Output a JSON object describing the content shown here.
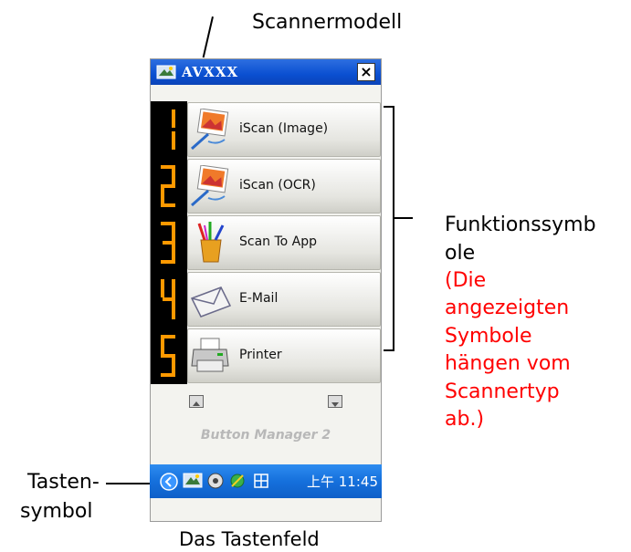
{
  "labels": {
    "scanner_model": "Scannermodell",
    "function_icons_1": "Funktionssymb",
    "function_icons_2": "ole",
    "note": [
      "(Die",
      "angezeigten",
      "Symbole",
      "hängen vom",
      "Scannertyp",
      "ab.)"
    ],
    "tray_icon_1": "Tasten-",
    "tray_icon_2": "symbol",
    "caption": "Das Tastenfeld"
  },
  "panel": {
    "title": "AVXXX",
    "close": "×",
    "buttons": [
      {
        "digit": "1",
        "label": "iScan (Image)",
        "icon": "image-scan-icon"
      },
      {
        "digit": "2",
        "label": "iScan (OCR)",
        "icon": "ocr-scan-icon"
      },
      {
        "digit": "3",
        "label": "Scan To App",
        "icon": "brush-cup-icon"
      },
      {
        "digit": "4",
        "label": "E-Mail",
        "icon": "envelope-icon"
      },
      {
        "digit": "5",
        "label": "Printer",
        "icon": "printer-icon"
      }
    ],
    "footer_label": "Button Manager 2"
  },
  "taskbar": {
    "clock": "上午 11:45"
  },
  "colors": {
    "note": "#ff0000",
    "titlebar": "#0a4fd1",
    "digit": "#ff9900"
  }
}
